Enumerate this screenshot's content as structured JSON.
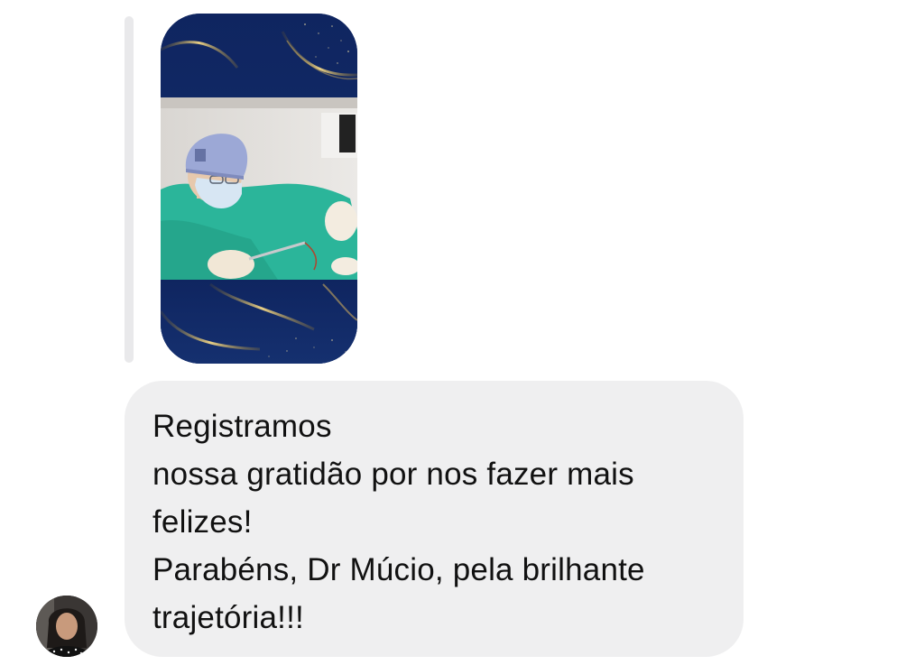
{
  "thread": {
    "reply": {
      "image_icon": "story-image",
      "indicator_color": "#e9e9eb"
    },
    "message": {
      "lines": [
        "Registramos",
        "nossa gratidão por nos fazer mais felizes!",
        "Parabéns, Dr Múcio, pela brilhante trajetória!!!"
      ],
      "bubble_color": "#efeff0",
      "text_color": "#111111"
    },
    "sender": {
      "avatar_icon": "avatar-photo"
    }
  }
}
